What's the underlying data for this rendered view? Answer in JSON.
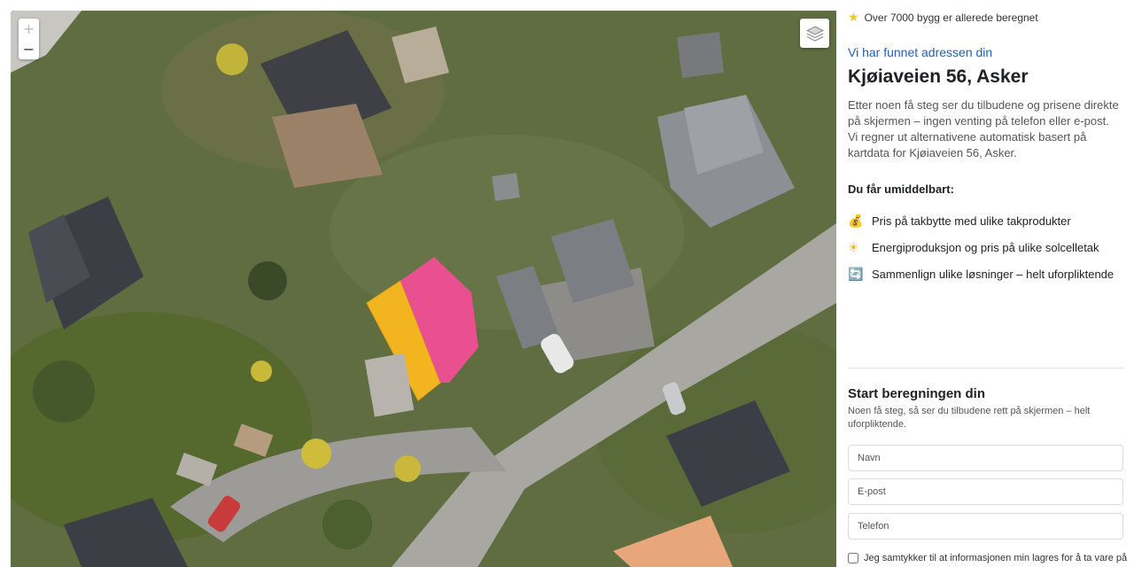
{
  "map": {
    "zoom_in_label": "+",
    "zoom_out_label": "−",
    "layers_icon": "layers-icon",
    "roof_colors": {
      "section_a": "#f2b51f",
      "section_b": "#e8508f"
    }
  },
  "panel": {
    "trust_icon": "star-icon",
    "trust_text": "Over 7000 bygg er allerede beregnet",
    "found_text": "Vi har funnet adressen din",
    "address": "Kjøiaveien 56, Asker",
    "lead": "Etter noen få steg ser du tilbudene og prisene direkte på skjermen – ingen venting på telefon eller e-post. Vi regner ut alternativene automatisk basert på kartdata for Kjøiaveien 56, Asker.",
    "benefits_title": "Du får umiddelbart:",
    "benefits": [
      {
        "icon": "money-bag-icon",
        "glyph": "💰",
        "text": "Pris på takbytte med ulike takprodukter"
      },
      {
        "icon": "sun-icon",
        "glyph": "☀",
        "text": "Energiproduksjon og pris på ulike solcelletak"
      },
      {
        "icon": "repeat-icon",
        "glyph": "🔄",
        "text": "Sammenlign ulike løsninger – helt uforpliktende"
      }
    ]
  },
  "form": {
    "title": "Start beregningen din",
    "subtitle": "Noen få steg, så ser du tilbudene rett på skjermen – helt uforpliktende.",
    "name_placeholder": "Navn",
    "email_placeholder": "E-post",
    "phone_placeholder": "Telefon",
    "consent_text": "Jeg samtykker til at informasjonen min lagres for å ta vare på"
  },
  "colors": {
    "accent": "#1f5fbf",
    "star": "#f3c623"
  }
}
